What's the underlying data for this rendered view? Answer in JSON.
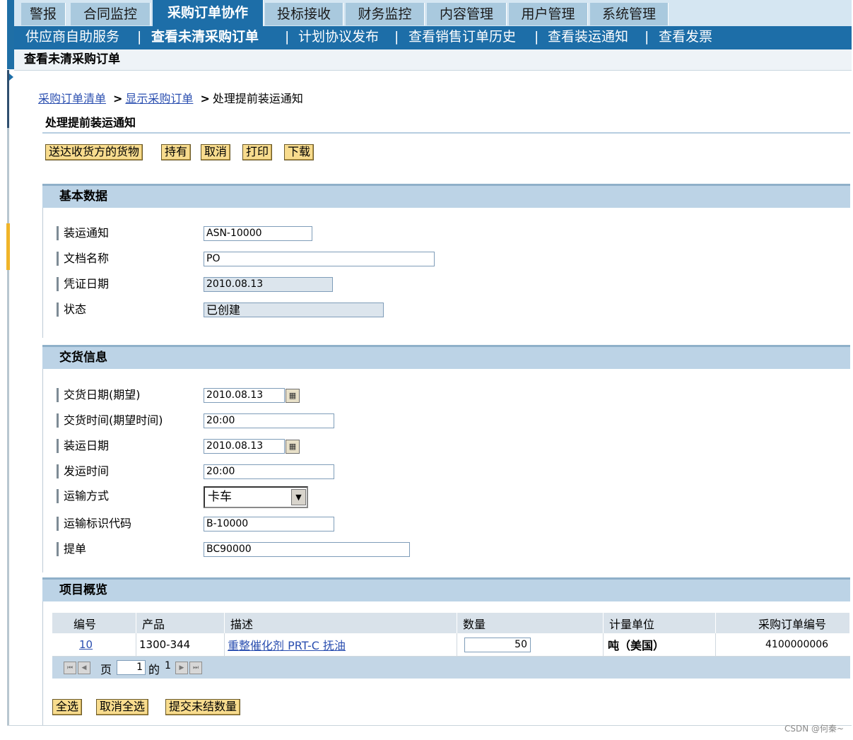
{
  "tabs": [
    "警报",
    "合同监控",
    "采购订单协作",
    "投标接收",
    "财务监控",
    "内容管理",
    "用户管理",
    "系统管理"
  ],
  "subnav": [
    "供应商自助服务",
    "查看未清采购订单",
    "计划协议发布",
    "查看销售订单历史",
    "查看装运通知",
    "查看发票"
  ],
  "subnav_sep": "|",
  "page_title": "查看未清采购订单",
  "breadcrumb": {
    "link1": "采购订单清单",
    "link2": "显示采购订单",
    "current": "处理提前装运通知",
    "arrow": ">"
  },
  "section_title": "处理提前装运通知",
  "actions": [
    "送达收货方的货物",
    "持有",
    "取消",
    "打印",
    "下载"
  ],
  "basic": {
    "title": "基本数据",
    "asn_label": "装运通知",
    "asn_value": "ASN-10000",
    "doc_label": "文档名称",
    "doc_value": "PO",
    "date_label": "凭证日期",
    "date_value": "2010.08.13",
    "status_label": "状态",
    "status_value": "已创建"
  },
  "delivery": {
    "title": "交货信息",
    "ddate_label": "交货日期(期望)",
    "ddate_value": "2010.08.13",
    "dtime_label": "交货时间(期望时间)",
    "dtime_value": "20:00",
    "sdate_label": "装运日期",
    "sdate_value": "2010.08.13",
    "stime_label": "发运时间",
    "stime_value": "20:00",
    "mode_label": "运输方式",
    "mode_value": "卡车",
    "mode_id_label": "运输标识代码",
    "mode_id_value": "B-10000",
    "bol_label": "提单",
    "bol_value": "BC90000"
  },
  "items": {
    "title": "项目概览",
    "columns": [
      "编号",
      "产品",
      "描述",
      "数量",
      "计量单位",
      "采购订单编号"
    ],
    "rows": [
      {
        "no": "10",
        "product": "1300-344",
        "desc": "重整催化剂 PRT-C 抚油",
        "qty": "50",
        "uom": "吨（美国）",
        "po": "4100000006"
      }
    ],
    "pager": {
      "page_label": "页",
      "page": "1",
      "of_label": "的",
      "total": "1"
    }
  },
  "bottom_actions": [
    "全选",
    "取消全选",
    "提交未结数量"
  ],
  "watermark": "CSDN @何秦~"
}
